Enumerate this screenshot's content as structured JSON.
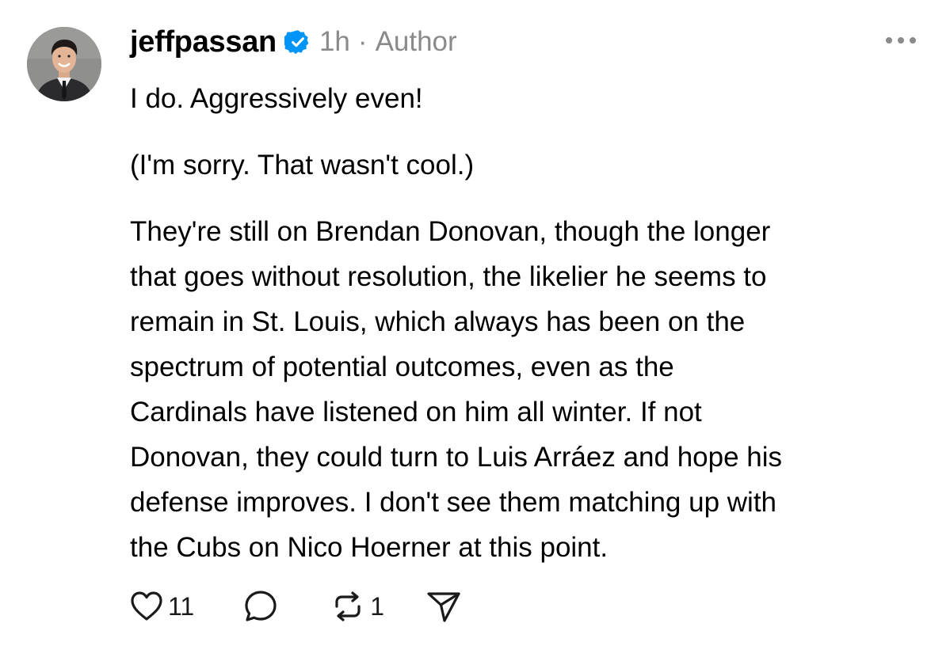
{
  "post": {
    "username": "jeffpassan",
    "verified_icon": "verified-badge-icon",
    "time": "1h",
    "separator": "·",
    "role": "Author",
    "paragraphs": [
      "I do. Aggressively even!",
      "(I'm sorry. That wasn't cool.)",
      "They're still on Brendan Donovan, though the longer\nthat goes without resolution, the likelier he seems to\nremain in St. Louis, which always has been on the\nspectrum of potential outcomes, even as the\nCardinals have listened on him all winter. If not\nDonovan, they could turn to Luis Arráez and hope his\ndefense improves. I don't see them matching up with\nthe Cubs on Nico Hoerner at this point."
    ],
    "like_count": "11",
    "repost_count": "1"
  },
  "icons": {
    "more": "more-dots-icon",
    "like": "heart-icon",
    "reply": "comment-bubble-icon",
    "repost": "repost-icon",
    "share": "send-plane-icon"
  },
  "colors": {
    "verified": "#0095f6",
    "meta_text": "#8a8a8a",
    "text": "#000000"
  }
}
